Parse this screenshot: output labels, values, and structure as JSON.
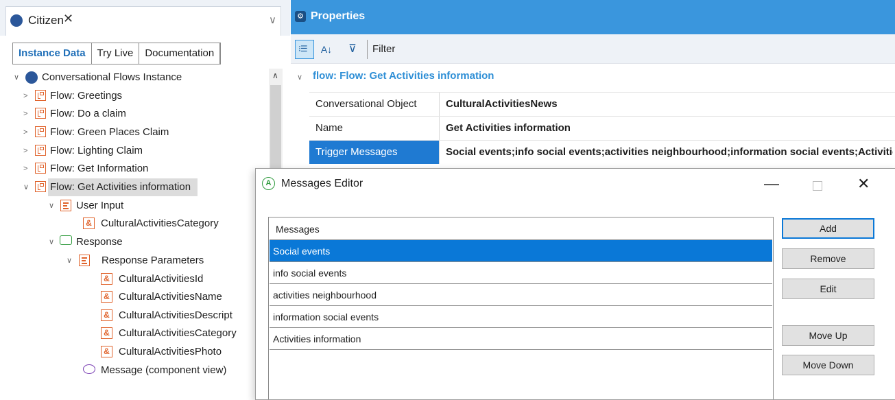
{
  "left": {
    "tab_title": "Citizen",
    "close_glyph": "✕",
    "chevron_glyph": "∨",
    "subtabs": [
      "Instance Data",
      "Try Live",
      "Documentation"
    ],
    "tree": {
      "root": "Conversational Flows Instance",
      "flows": [
        "Flow: Greetings",
        "Flow: Do a claim",
        "Flow: Green Places Claim",
        "Flow: Lighting Claim",
        "Flow: Get Information",
        "Flow: Get Activities information"
      ],
      "user_input": "User Input",
      "user_input_param": "CulturalActivitiesCategory",
      "response": "Response",
      "response_parameters": "Response Parameters",
      "response_params": [
        "CulturalActivitiesId",
        "CulturalActivitiesName",
        "CulturalActivitiesDescript",
        "CulturalActivitiesCategory",
        "CulturalActivitiesPhoto"
      ],
      "message": "Message (component view)"
    }
  },
  "properties": {
    "title": "Properties",
    "filter_label": "Filter",
    "group": "flow: Flow: Get Activities information",
    "rows": [
      {
        "key": "Conversational Object",
        "value": "CulturalActivitiesNews"
      },
      {
        "key": "Name",
        "value": "Get Activities information"
      },
      {
        "key": "Trigger Messages",
        "value": "Social events;info social events;activities neighbourhood;information social events;Activities information"
      }
    ]
  },
  "dialog": {
    "title": "Messages Editor",
    "list_header": "Messages",
    "messages": [
      "Social events",
      "info social events",
      "activities neighbourhood",
      "information social events",
      "Activities information"
    ],
    "selected_index": 0,
    "buttons": {
      "add": "Add",
      "remove": "Remove",
      "edit": "Edit",
      "move_up": "Move Up",
      "move_down": "Move Down"
    }
  },
  "colors": {
    "accent": "#3a96dd",
    "selection": "#0a78d7",
    "icon_orange": "#e0622a"
  }
}
